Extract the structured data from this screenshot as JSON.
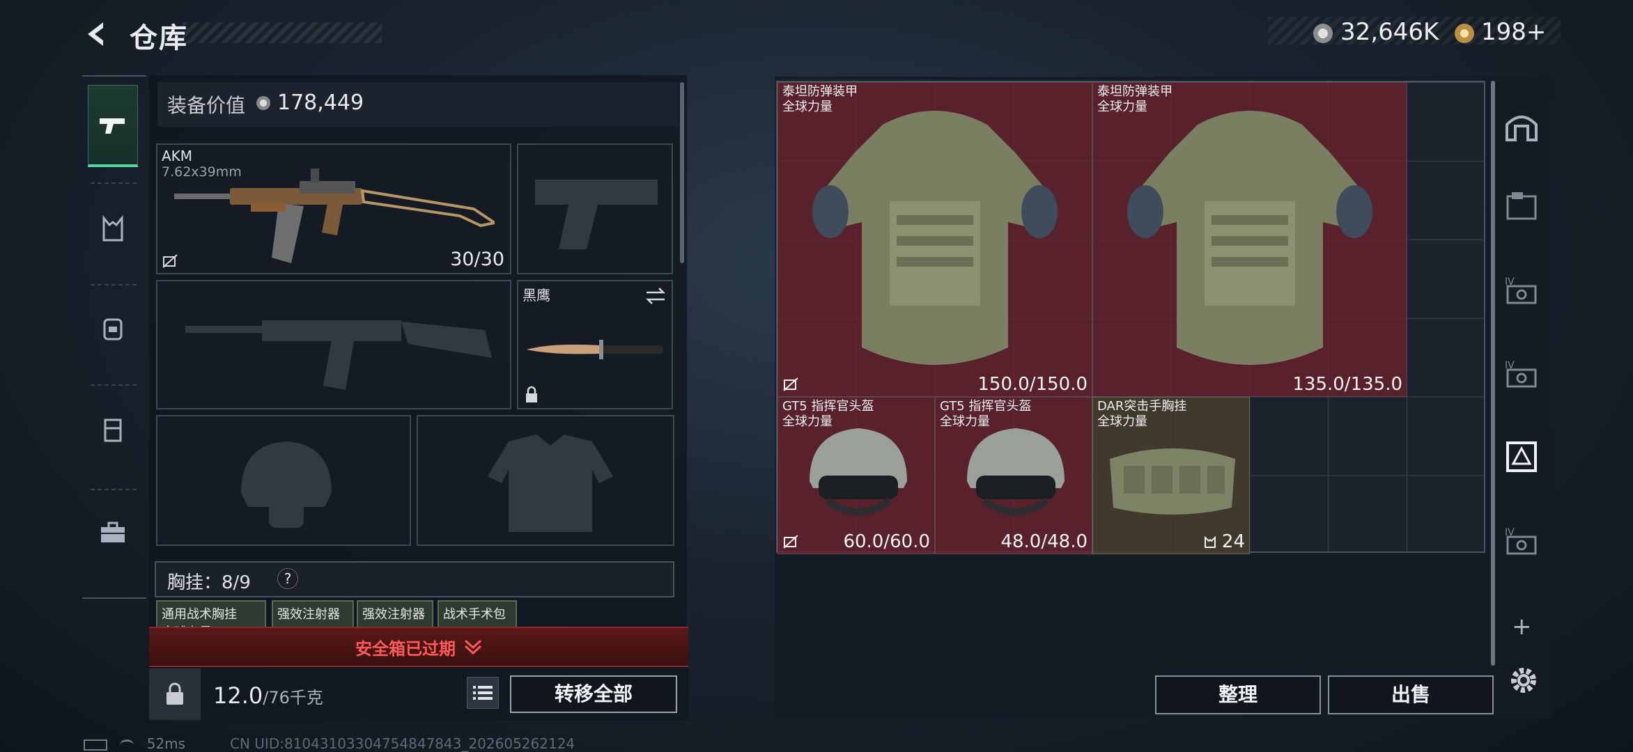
{
  "header": {
    "title": "仓库"
  },
  "currency": {
    "coins": "32,646K",
    "premium": "198",
    "premium_plus": "+"
  },
  "equipment": {
    "value_label": "装备价值",
    "value": "178,449",
    "primary_weapon": {
      "name": "AKM",
      "caliber": "7.62x39mm",
      "ammo": "30/30"
    },
    "melee": {
      "name": "黑鹰"
    },
    "rig_label": "胸挂：",
    "rig_count": "8/9",
    "rig_help": "?",
    "rig_items": [
      "通用战术胸挂",
      "强效注射器",
      "强效注射器",
      "战术手术包"
    ],
    "rig_items_sub": "全球力量"
  },
  "safe_box": {
    "text": "安全箱已过期"
  },
  "weight": {
    "current": "12.0",
    "max": "/76千克"
  },
  "buttons": {
    "transfer_all": "转移全部",
    "sort": "整理",
    "sell": "出售"
  },
  "storage": {
    "items": [
      {
        "name": "泰坦防弹装甲",
        "sub": "全球力量",
        "value": "150.0/150.0"
      },
      {
        "name": "泰坦防弹装甲",
        "sub": "全球力量",
        "value": "135.0/135.0"
      },
      {
        "name": "GT5 指挥官头盔",
        "sub": "全球力量",
        "value": "60.0/60.0"
      },
      {
        "name": "GT5 指挥官头盔",
        "sub": "全球力量",
        "value": "48.0/48.0"
      },
      {
        "name": "DAR突击手胸挂",
        "sub": "全球力量",
        "value": "24"
      }
    ]
  },
  "status": {
    "ping": "52ms",
    "uid": "CN UID:8104310330475484784​3_202605262124"
  },
  "colors": {
    "accent": "#52d9a4",
    "alert": "#ff5a5a",
    "item_bg": "#6e222c"
  }
}
